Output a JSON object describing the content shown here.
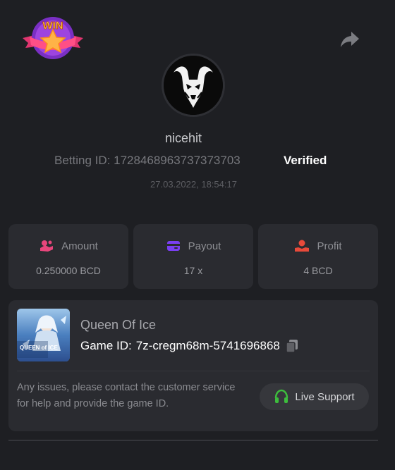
{
  "header": {
    "badge_text": "WIN",
    "share_icon": "share-icon"
  },
  "profile": {
    "username": "nicehit",
    "betting_id_label": "Betting ID:",
    "betting_id_value": "1728468963737373703",
    "verified_label": "Verified",
    "timestamp": "27.03.2022, 18:54:17"
  },
  "stats": [
    {
      "label": "Amount",
      "value": "0.250000 BCD",
      "icon": "coins-icon",
      "color": "#e8467c"
    },
    {
      "label": "Payout",
      "value": "17 x",
      "icon": "card-icon",
      "color": "#7a3ff2"
    },
    {
      "label": "Profit",
      "value": "4 BCD",
      "icon": "hand-coin-icon",
      "color": "#e84a3a"
    }
  ],
  "game": {
    "name": "Queen Of Ice",
    "id_label": "Game ID:",
    "id_value": "7z-cregm68m-5741696868",
    "thumb_text": "QUEEN of ICE",
    "issues_text": "Any issues, please contact the customer service for help and provide the game ID.",
    "support_label": "Live Support",
    "support_color": "#3dbd3d"
  }
}
